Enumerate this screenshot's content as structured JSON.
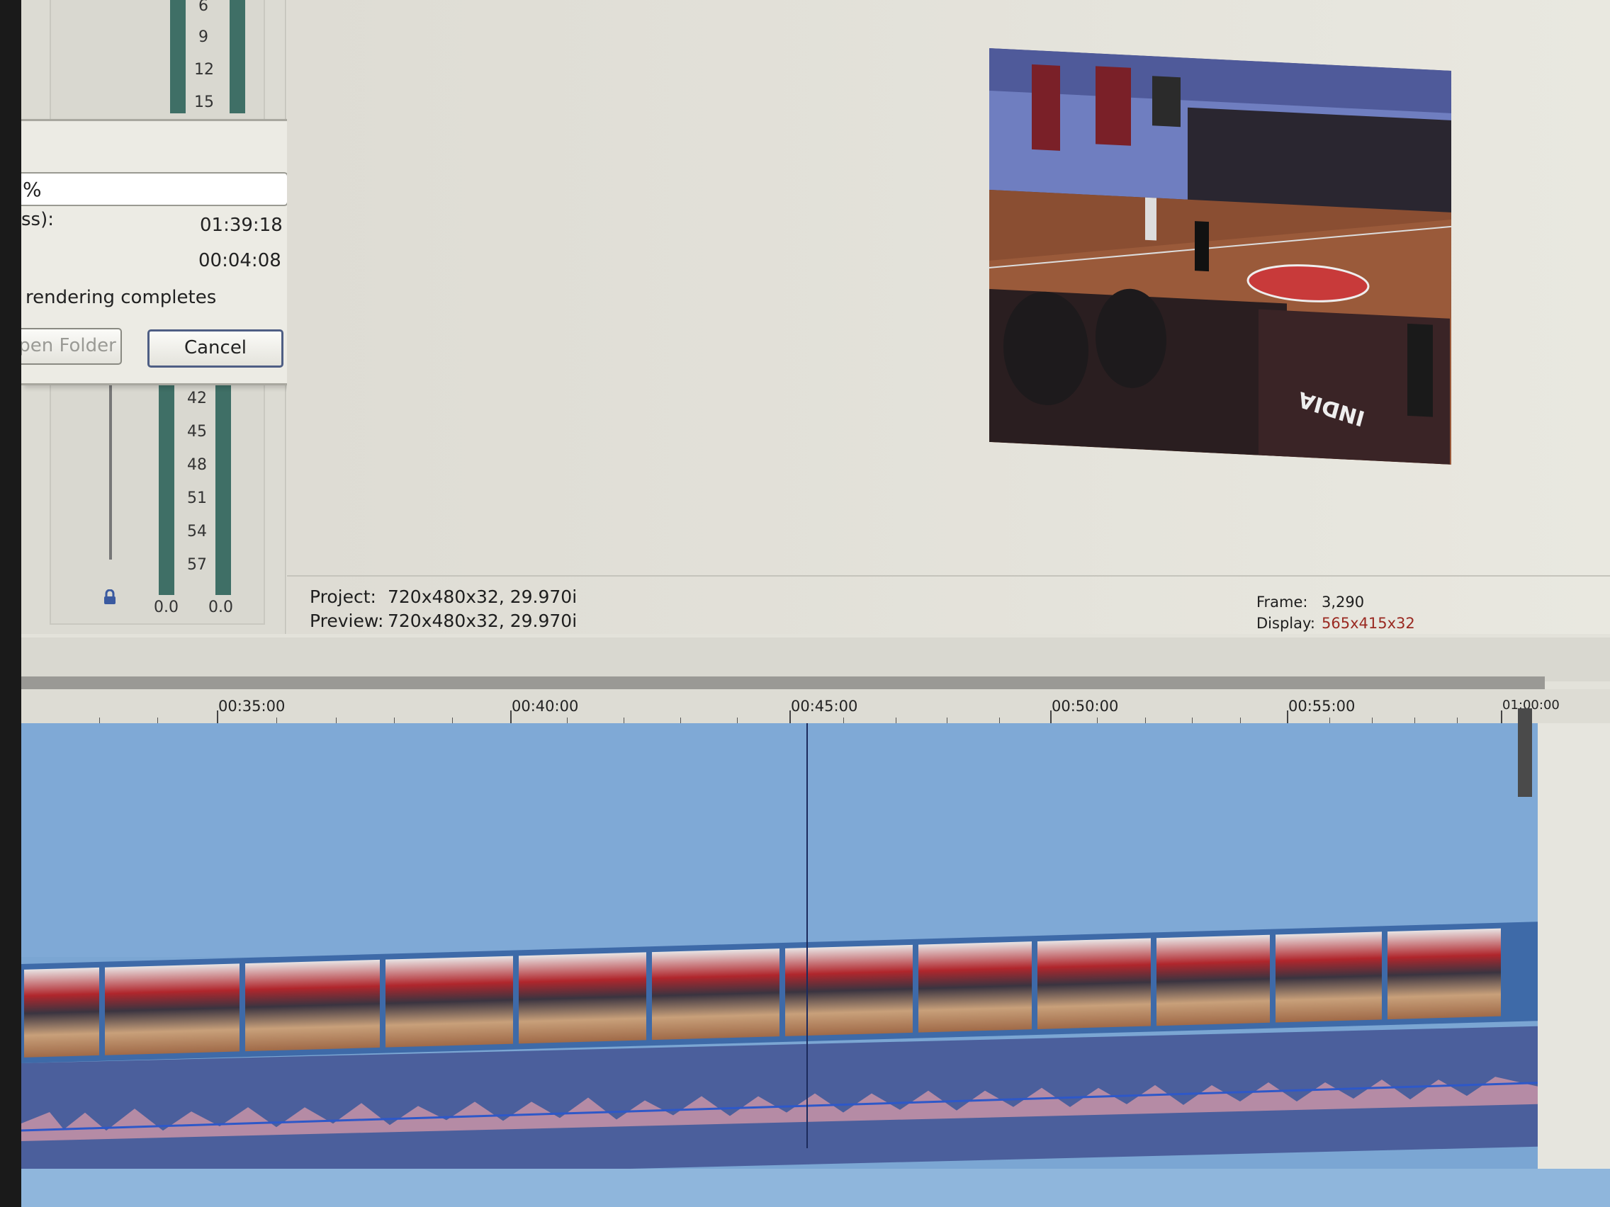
{
  "meter": {
    "scale_top": [
      "6",
      "9",
      "12",
      "15"
    ],
    "scale_bottom": [
      "42",
      "45",
      "48",
      "51",
      "54",
      "57"
    ],
    "left_value": "0.0",
    "right_value": "0.0"
  },
  "render_dialog": {
    "progress_text": "%",
    "time_label": "ss):",
    "elapsed_value": "01:39:18",
    "remaining_value": "00:04:08",
    "checkbox_label": "rendering completes",
    "open_folder_label": "pen Folder",
    "cancel_label": "Cancel"
  },
  "preview_info": {
    "project_label": "Project:",
    "project_value": "720x480x32, 29.970i",
    "preview_label": "Preview:",
    "preview_value": "720x480x32, 29.970i",
    "frame_label": "Frame:",
    "frame_value": "3,290",
    "display_label": "Display:",
    "display_value": "565x415x32"
  },
  "timeline": {
    "ruler_labels": [
      "00:35:00",
      "00:40:00",
      "00:45:00",
      "00:50:00",
      "00:55:00",
      "01:00:00"
    ]
  },
  "colors": {
    "track_blue": "#7ba6d3",
    "audio_track": "#4b5f9c",
    "display_value_red": "#9a2a22"
  }
}
